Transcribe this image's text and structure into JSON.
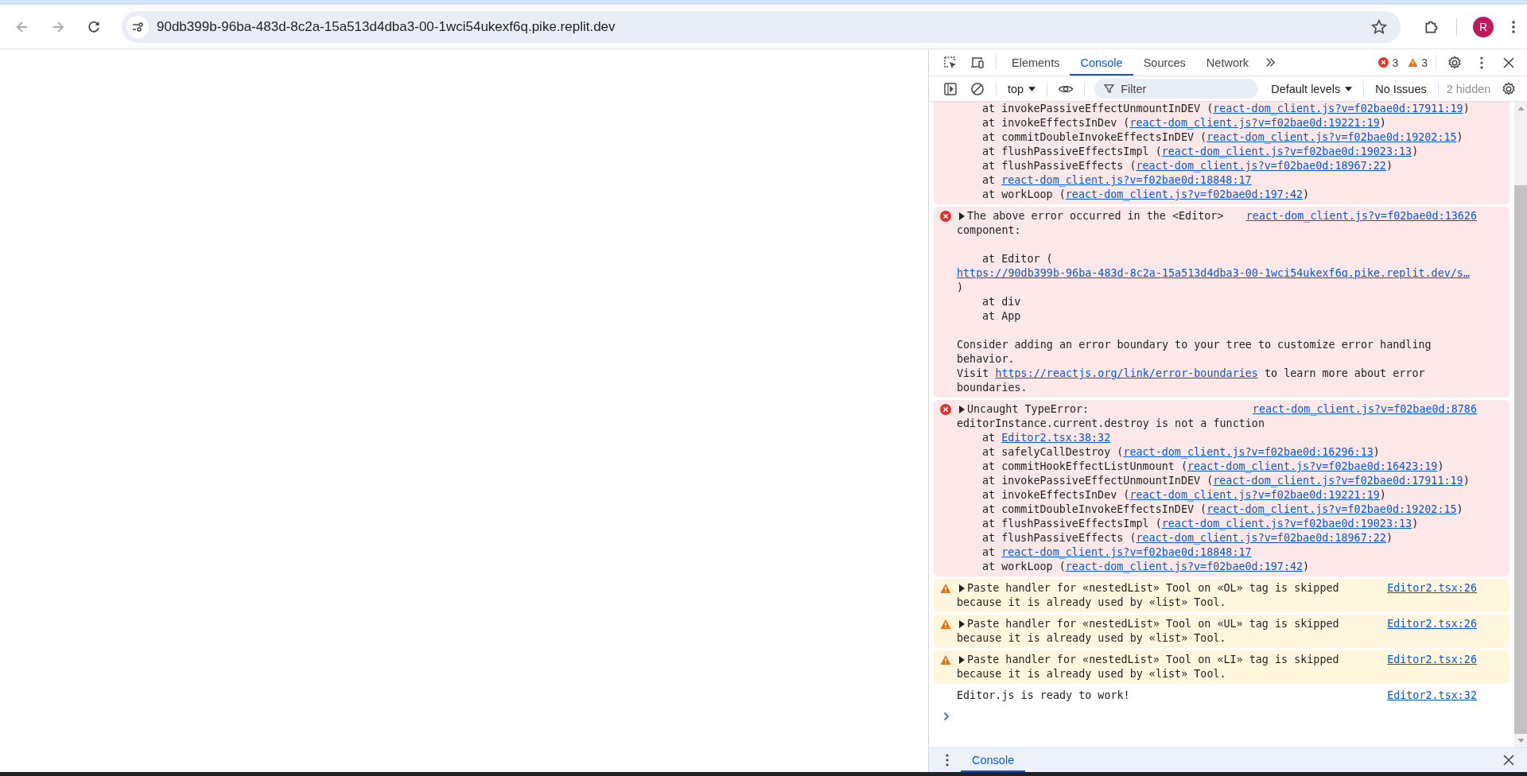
{
  "browser": {
    "url": "90db399b-96ba-483d-8c2a-15a513d4dba3-00-1wci54ukexf6q.pike.replit.dev",
    "profile_initial": "R"
  },
  "devtools": {
    "tabs": [
      {
        "label": "Elements",
        "selected": false
      },
      {
        "label": "Console",
        "selected": true
      },
      {
        "label": "Sources",
        "selected": false
      },
      {
        "label": "Network",
        "selected": false
      }
    ],
    "error_count": "3",
    "warning_count": "3"
  },
  "console_toolbar": {
    "context": "top",
    "filter_placeholder": "Filter",
    "levels": "Default levels",
    "issues": "No Issues",
    "hidden": "2 hidden"
  },
  "messages": [
    {
      "kind": "error",
      "cut_off": true,
      "lines": [
        {
          "kind": "frame",
          "segments": [
            {
              "text": "at invokePassiveEffectUnmountInDEV ("
            },
            {
              "link": "react-dom_client.js?v=f02bae0d:17911:19"
            },
            {
              "text": ")"
            }
          ]
        },
        {
          "kind": "frame",
          "segments": [
            {
              "text": "at invokeEffectsInDev ("
            },
            {
              "link": "react-dom_client.js?v=f02bae0d:19221:19"
            },
            {
              "text": ")"
            }
          ]
        },
        {
          "kind": "frame",
          "segments": [
            {
              "text": "at commitDoubleInvokeEffectsInDEV ("
            },
            {
              "link": "react-dom_client.js?v=f02bae0d:19202:15"
            },
            {
              "text": ")"
            }
          ]
        },
        {
          "kind": "frame",
          "segments": [
            {
              "text": "at flushPassiveEffectsImpl ("
            },
            {
              "link": "react-dom_client.js?v=f02bae0d:19023:13"
            },
            {
              "text": ")"
            }
          ]
        },
        {
          "kind": "frame",
          "segments": [
            {
              "text": "at flushPassiveEffects ("
            },
            {
              "link": "react-dom_client.js?v=f02bae0d:18967:22"
            },
            {
              "text": ")"
            }
          ]
        },
        {
          "kind": "frame",
          "segments": [
            {
              "text": "at "
            },
            {
              "link": "react-dom_client.js?v=f02bae0d:18848:17"
            }
          ]
        },
        {
          "kind": "frame",
          "segments": [
            {
              "text": "at workLoop ("
            },
            {
              "link": "react-dom_client.js?v=f02bae0d:197:42"
            },
            {
              "text": ")"
            }
          ]
        }
      ]
    },
    {
      "kind": "error",
      "cut_off": false,
      "expandable": true,
      "source": "react-dom_client.js?v=f02bae0d:13626",
      "text_lines": [
        "The above error occurred in the <Editor>",
        "component:"
      ],
      "lines": [
        {
          "kind": "frame",
          "gap_before": true,
          "segments": [
            {
              "text": "at Editor ("
            }
          ]
        },
        {
          "kind": "text",
          "segments": [
            {
              "link": "https://90db399b-96ba-483d-8c2a-15a513d4dba3-00-1wci54ukexf6q.pike.replit.dev/s…"
            }
          ]
        },
        {
          "kind": "text",
          "segments": [
            {
              "text": ")"
            }
          ]
        },
        {
          "kind": "frame",
          "segments": [
            {
              "text": "at div"
            }
          ]
        },
        {
          "kind": "frame",
          "segments": [
            {
              "text": "at App"
            }
          ]
        },
        {
          "kind": "text",
          "gap_before": true,
          "segments": [
            {
              "text": "Consider adding an error boundary to your tree to customize error handling behavior."
            }
          ]
        },
        {
          "kind": "text",
          "segments": [
            {
              "text": "Visit "
            },
            {
              "link": "https://reactjs.org/link/error-boundaries"
            },
            {
              "text": " to learn more about error boundaries."
            }
          ]
        }
      ]
    },
    {
      "kind": "error",
      "cut_off": false,
      "expandable": true,
      "source": "react-dom_client.js?v=f02bae0d:8786",
      "text_lines": [
        "Uncaught TypeError:",
        "editorInstance.current.destroy is not a function"
      ],
      "lines": [
        {
          "kind": "frame",
          "segments": [
            {
              "text": "at "
            },
            {
              "link": "Editor2.tsx:38:32"
            }
          ]
        },
        {
          "kind": "frame",
          "segments": [
            {
              "text": "at safelyCallDestroy ("
            },
            {
              "link": "react-dom_client.js?v=f02bae0d:16296:13"
            },
            {
              "text": ")"
            }
          ]
        },
        {
          "kind": "frame",
          "segments": [
            {
              "text": "at commitHookEffectListUnmount ("
            },
            {
              "link": "react-dom_client.js?v=f02bae0d:16423:19"
            },
            {
              "text": ")"
            }
          ]
        },
        {
          "kind": "frame",
          "segments": [
            {
              "text": "at invokePassiveEffectUnmountInDEV ("
            },
            {
              "link": "react-dom_client.js?v=f02bae0d:17911:19"
            },
            {
              "text": ")"
            }
          ]
        },
        {
          "kind": "frame",
          "segments": [
            {
              "text": "at invokeEffectsInDev ("
            },
            {
              "link": "react-dom_client.js?v=f02bae0d:19221:19"
            },
            {
              "text": ")"
            }
          ]
        },
        {
          "kind": "frame",
          "segments": [
            {
              "text": "at commitDoubleInvokeEffectsInDEV ("
            },
            {
              "link": "react-dom_client.js?v=f02bae0d:19202:15"
            },
            {
              "text": ")"
            }
          ]
        },
        {
          "kind": "frame",
          "segments": [
            {
              "text": "at flushPassiveEffectsImpl ("
            },
            {
              "link": "react-dom_client.js?v=f02bae0d:19023:13"
            },
            {
              "text": ")"
            }
          ]
        },
        {
          "kind": "frame",
          "segments": [
            {
              "text": "at flushPassiveEffects ("
            },
            {
              "link": "react-dom_client.js?v=f02bae0d:18967:22"
            },
            {
              "text": ")"
            }
          ]
        },
        {
          "kind": "frame",
          "segments": [
            {
              "text": "at "
            },
            {
              "link": "react-dom_client.js?v=f02bae0d:18848:17"
            }
          ]
        },
        {
          "kind": "frame",
          "segments": [
            {
              "text": "at workLoop ("
            },
            {
              "link": "react-dom_client.js?v=f02bae0d:197:42"
            },
            {
              "text": ")"
            }
          ]
        }
      ]
    },
    {
      "kind": "warning",
      "cut_off": false,
      "expandable": true,
      "source": "Editor2.tsx:26",
      "text_lines": [
        "Paste handler for «nestedList» Tool on «OL» tag is skipped",
        "because it is already used by «list» Tool."
      ]
    },
    {
      "kind": "warning",
      "cut_off": false,
      "expandable": true,
      "source": "Editor2.tsx:26",
      "text_lines": [
        "Paste handler for «nestedList» Tool on «UL» tag is skipped",
        "because it is already used by «list» Tool."
      ]
    },
    {
      "kind": "warning",
      "cut_off": false,
      "expandable": true,
      "source": "Editor2.tsx:26",
      "text_lines": [
        "Paste handler for «nestedList» Tool on «LI» tag is skipped",
        "because it is already used by «list» Tool."
      ]
    },
    {
      "kind": "info",
      "cut_off": false,
      "expandable": false,
      "source": "Editor2.tsx:32",
      "text_lines": [
        "Editor.js is ready to work!"
      ]
    }
  ],
  "drawer": {
    "tabs": [
      {
        "label": "Console",
        "selected": true
      }
    ]
  }
}
